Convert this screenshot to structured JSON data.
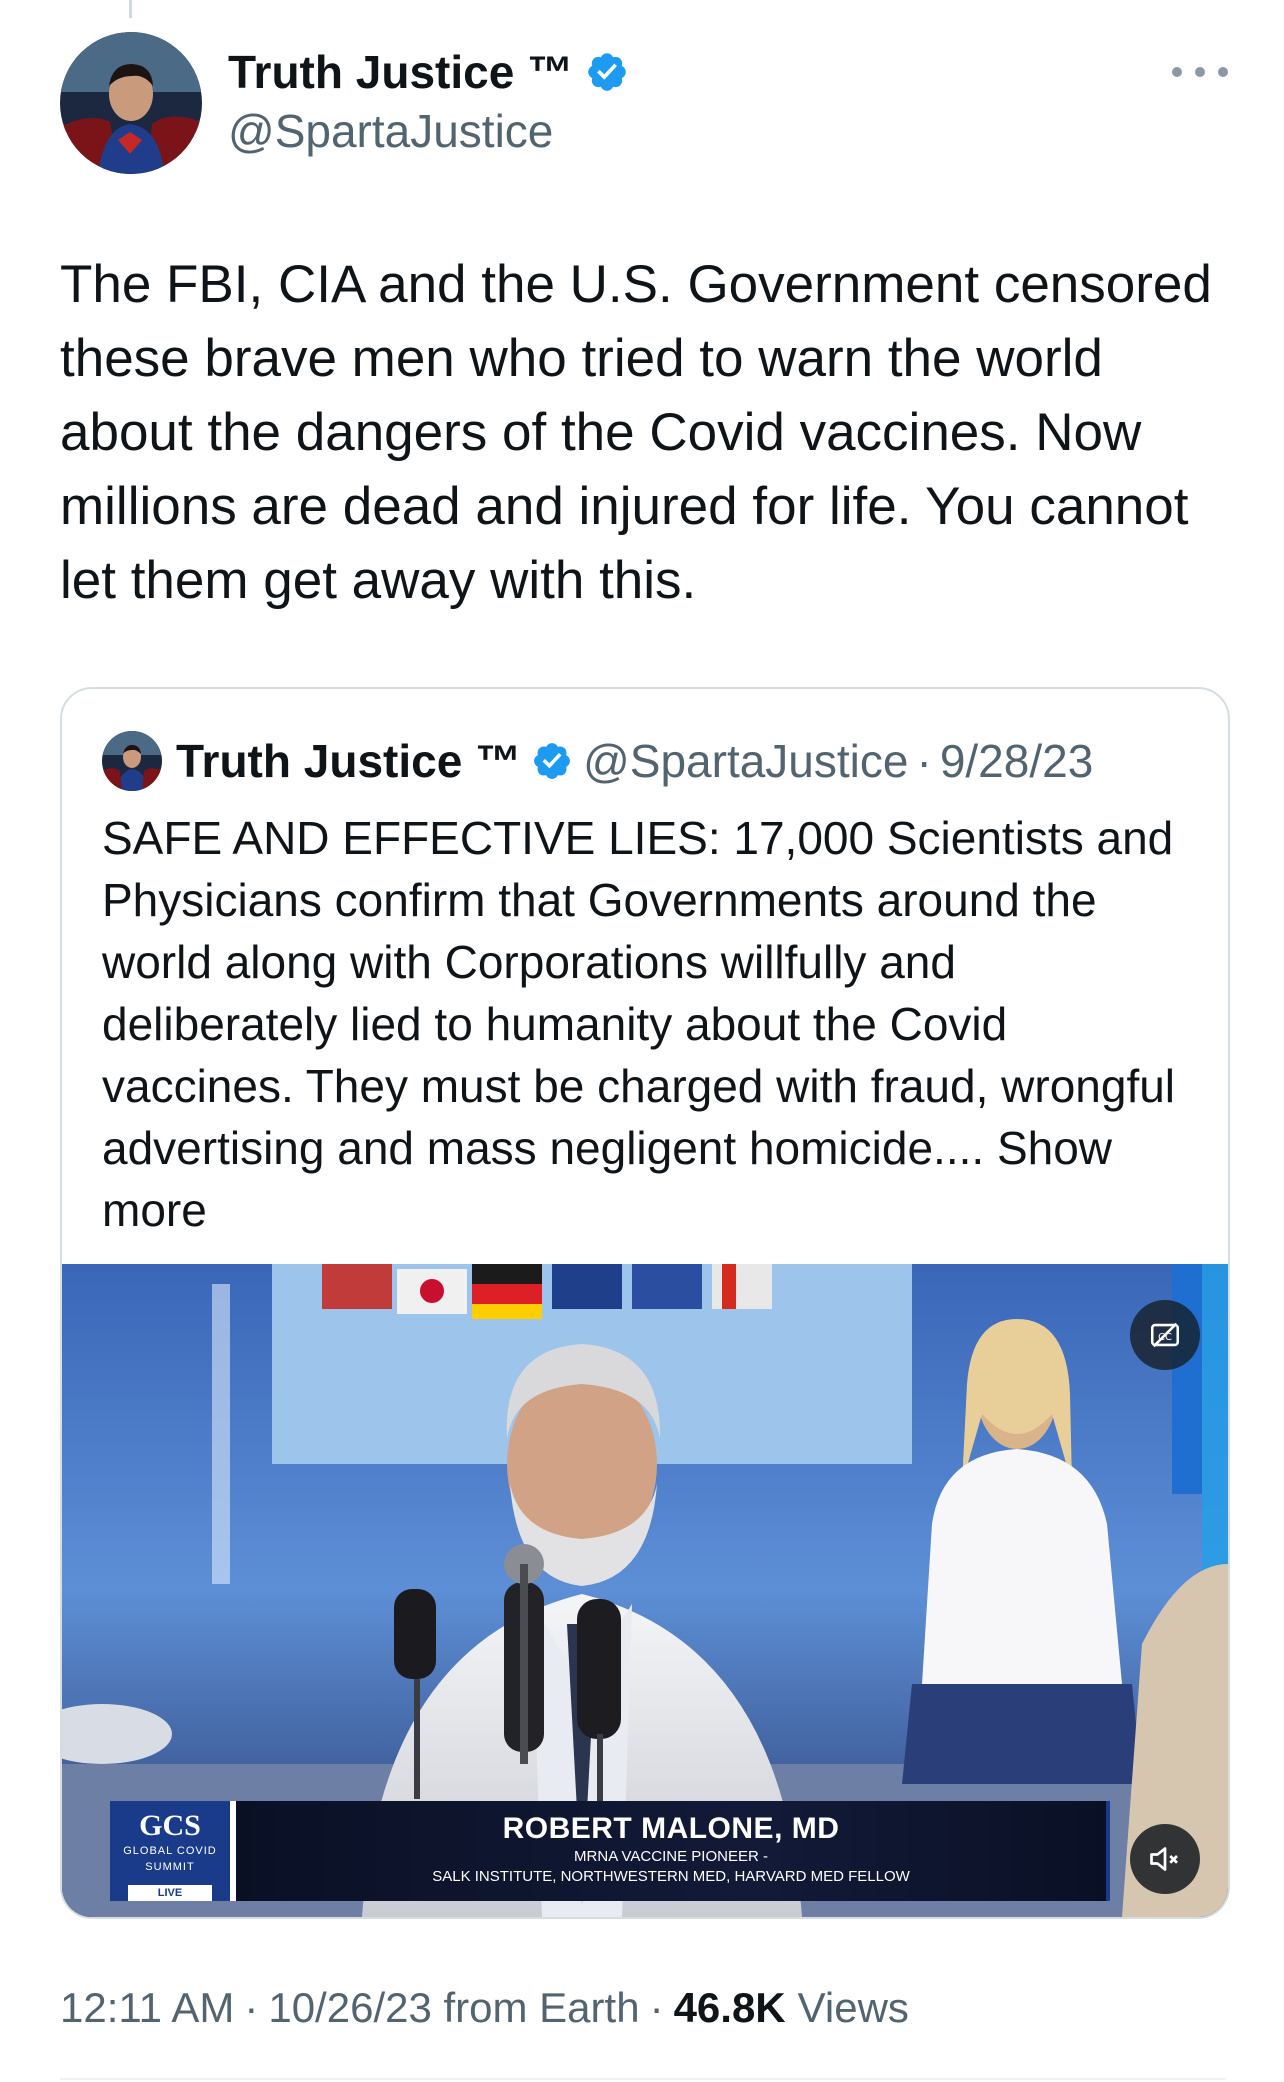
{
  "tweet": {
    "display_name": "Truth Justice ™",
    "handle": "@SpartaJustice",
    "verified": true,
    "text": "The FBI, CIA and the U.S. Government censored these brave men who tried to warn the world about the dangers of the Covid vaccines. Now millions are dead and injured for life. You cannot let them get away with this.",
    "more_icon": "more-horizontal-icon"
  },
  "quote": {
    "display_name": "Truth Justice ™",
    "handle": "@SpartaJustice",
    "separator": "·",
    "date": "9/28/23",
    "text": "SAFE AND EFFECTIVE LIES: 17,000 Scientists and Physicians confirm that Governments around the world along with Corporations willfully and deliberately lied to humanity about the Covid vaccines. They must be charged with fraud, wrongful advertising and mass negligent homicide....",
    "show_more": "Show more",
    "video": {
      "captions_icon": "closed-captions-off-icon",
      "mute_icon": "volume-muted-icon",
      "lower_third": {
        "logo": "GCS",
        "logo_sub_1": "GLOBAL COVID",
        "logo_sub_2": "SUMMIT",
        "live": "LIVE",
        "name": "ROBERT MALONE, MD",
        "subtitle_1": "MRNA VACCINE PIONEER -",
        "subtitle_2": "SALK INSTITUTE, NORTHWESTERN MED, HARVARD MED FELLOW"
      }
    }
  },
  "meta": {
    "time": "12:11 AM",
    "separator": "·",
    "date_source": "10/26/23 from Earth",
    "views_count": "46.8K",
    "views_label": "Views"
  },
  "colors": {
    "text_primary": "#0f1419",
    "text_secondary": "#536471",
    "verified_blue": "#1d9bf0",
    "border": "#d6dde2"
  }
}
